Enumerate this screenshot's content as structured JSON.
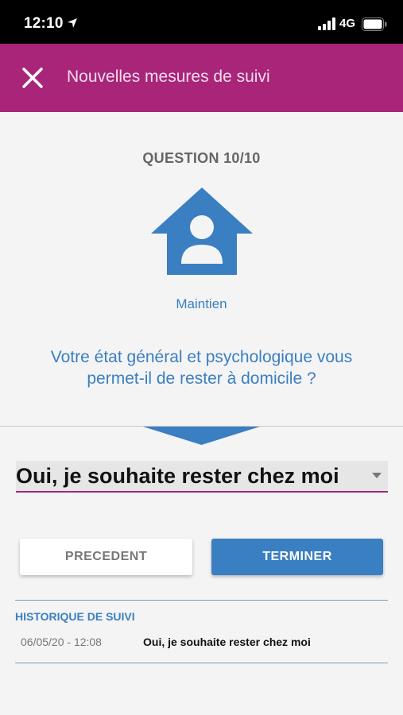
{
  "status_bar": {
    "time": "12:10",
    "network": "4G",
    "icons": [
      "location-arrow-icon",
      "signal-bars-icon",
      "battery-icon"
    ]
  },
  "header": {
    "title": "Nouvelles mesures de suivi",
    "close_icon": "close-icon",
    "background_color": "#a8257a"
  },
  "question": {
    "counter": "QUESTION 10/10",
    "icon": "home-person-icon",
    "category": "Maintien",
    "text": "Votre état général et psychologique vous permet-il de rester à domicile ?",
    "accent_color": "#3a7fc1"
  },
  "answer": {
    "selected": "Oui, je souhaite rester chez moi",
    "dropdown_icon": "dropdown-caret-icon"
  },
  "buttons": {
    "previous": "PRECEDENT",
    "finish": "TERMINER"
  },
  "history": {
    "title": "HISTORIQUE DE SUIVI",
    "entries": [
      {
        "date": "06/05/20 - 12:08",
        "answer": "Oui, je souhaite rester chez moi"
      }
    ]
  }
}
